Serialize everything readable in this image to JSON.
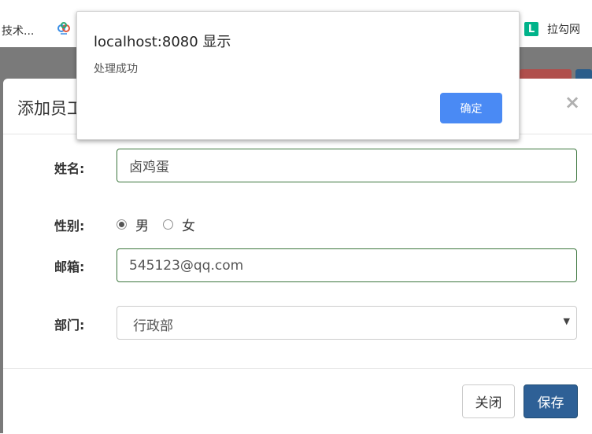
{
  "bookmarks": {
    "left_item": "技术...",
    "left_icon": "cloud-logo-icon",
    "right_item": "拉勾网",
    "right_icon": "lagou-logo-icon",
    "right_icon_letter": "L"
  },
  "modal": {
    "title": "添加员工",
    "close_symbol": "×",
    "fields": {
      "name_label": "姓名:",
      "name_value": "卤鸡蛋",
      "gender_label": "性别:",
      "gender_options": [
        "男",
        "女"
      ],
      "gender_selected": "男",
      "email_label": "邮箱:",
      "email_value": "545123@qq.com",
      "dept_label": "部门:",
      "dept_value": "行政部"
    },
    "footer": {
      "close_label": "关闭",
      "save_label": "保存"
    }
  },
  "alert": {
    "title": "localhost:8080 显示",
    "message": "处理成功",
    "ok_label": "确定"
  },
  "colors": {
    "input_border_success": "#3c763d",
    "save_button": "#2e6096",
    "alert_ok_button": "#4a8af4",
    "backdrop": "#7a7a7a"
  }
}
